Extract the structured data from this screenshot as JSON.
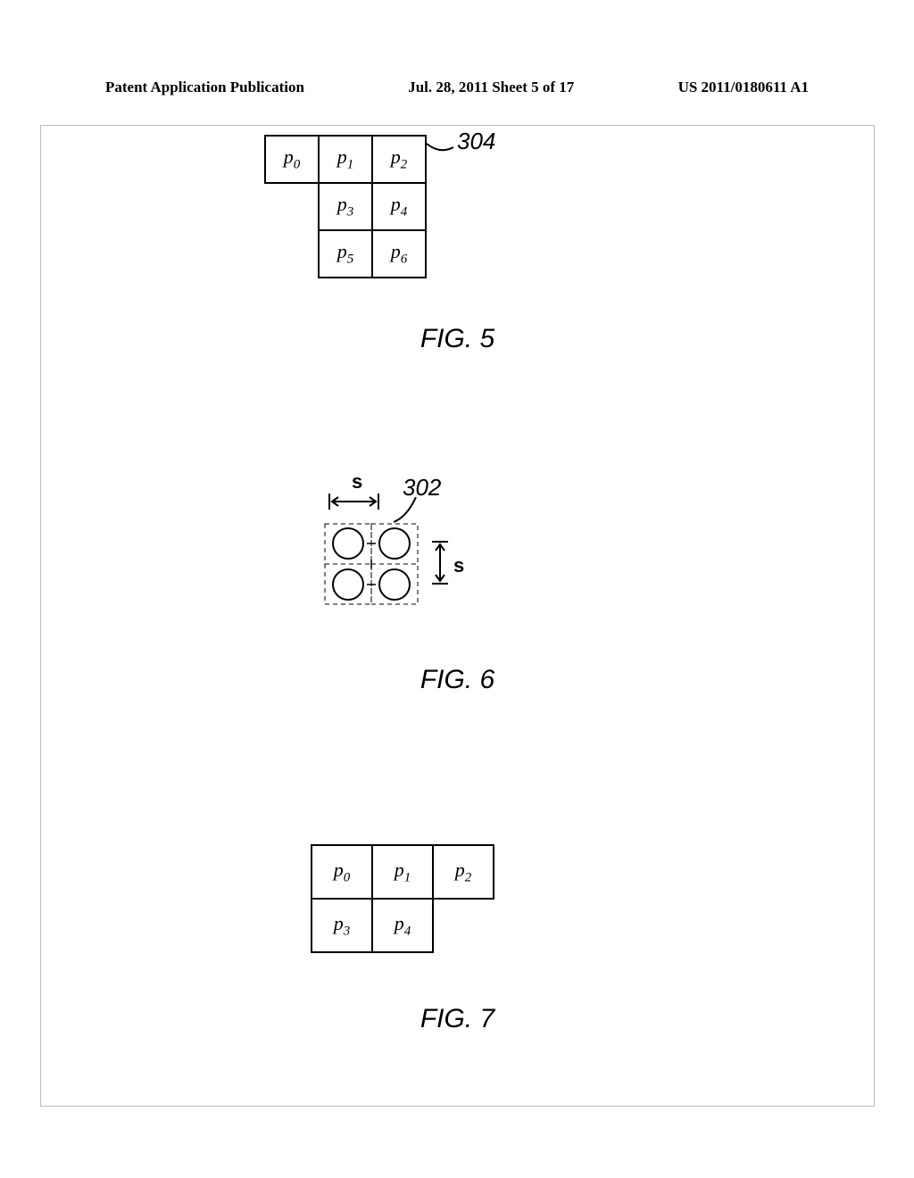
{
  "header": {
    "left": "Patent Application Publication",
    "middle": "Jul. 28, 2011  Sheet 5 of 17",
    "right": "US 2011/0180611 A1"
  },
  "fig5": {
    "label": "FIG. 5",
    "callout": "304",
    "cells": [
      "p",
      "p",
      "p",
      "p",
      "p",
      "p",
      "p"
    ],
    "subs": [
      "0",
      "1",
      "2",
      "3",
      "4",
      "5",
      "6"
    ]
  },
  "fig6": {
    "label": "FIG. 6",
    "callout": "302",
    "s_top": "s",
    "s_right": "s"
  },
  "fig7": {
    "label": "FIG. 7",
    "cells": [
      "p",
      "p",
      "p",
      "p",
      "p"
    ],
    "subs": [
      "0",
      "1",
      "2",
      "3",
      "4"
    ]
  },
  "chart_data": {
    "type": "table",
    "figures": [
      {
        "id": "FIG. 5",
        "callout_ref": 304,
        "grid": [
          [
            "p0",
            "p1",
            "p2"
          ],
          [
            null,
            "p3",
            "p4"
          ],
          [
            null,
            "p5",
            "p6"
          ]
        ]
      },
      {
        "id": "FIG. 6",
        "callout_ref": 302,
        "description": "2x2 dot macro unit with spacing s in horizontal and vertical directions",
        "s_horizontal_label": "s",
        "s_vertical_label": "s"
      },
      {
        "id": "FIG. 7",
        "grid": [
          [
            "p0",
            "p1",
            "p2"
          ],
          [
            "p3",
            "p4",
            null
          ]
        ]
      }
    ]
  }
}
